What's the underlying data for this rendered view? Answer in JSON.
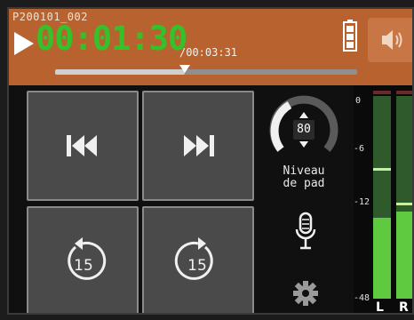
{
  "header": {
    "filename": "P200101_002",
    "time_main": "00:01:30",
    "time_total": "/00:03:31",
    "progress_fraction": 0.43
  },
  "buttons": {
    "prev": "previous-track-icon",
    "next": "next-track-icon",
    "rewind": {
      "icon": "rewind-15-icon",
      "label": "15"
    },
    "forward": {
      "icon": "forward-15-icon",
      "label": "15"
    }
  },
  "pad": {
    "value": "80",
    "label_line1": "Niveau",
    "label_line2": "de pad"
  },
  "meters": {
    "scale": [
      "0",
      "-6",
      "-12",
      "-48"
    ],
    "left": {
      "label": "L",
      "level": 0.4,
      "peak": 0.63
    },
    "right": {
      "label": "R",
      "level": 0.43,
      "peak": 0.46
    }
  },
  "colors": {
    "header": "#b8632f",
    "time_green": "#35c12a",
    "meter_green": "#5fc93f",
    "button_grey": "#4a4a4a"
  }
}
